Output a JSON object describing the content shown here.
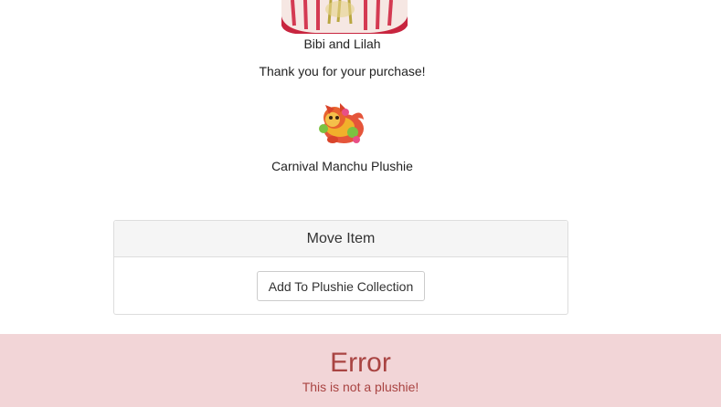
{
  "shop": {
    "shopkeeper_name": "Bibi and Lilah",
    "thank_you": "Thank you for your purchase!"
  },
  "purchased_item": {
    "name": "Carnival Manchu Plushie",
    "icon": "plushie-image"
  },
  "move_panel": {
    "title": "Move Item",
    "button_label": "Add To Plushie Collection"
  },
  "error": {
    "title": "Error",
    "message": "This is not a plushie!",
    "bg_color": "#f2d5d7",
    "text_color": "#a94442"
  }
}
